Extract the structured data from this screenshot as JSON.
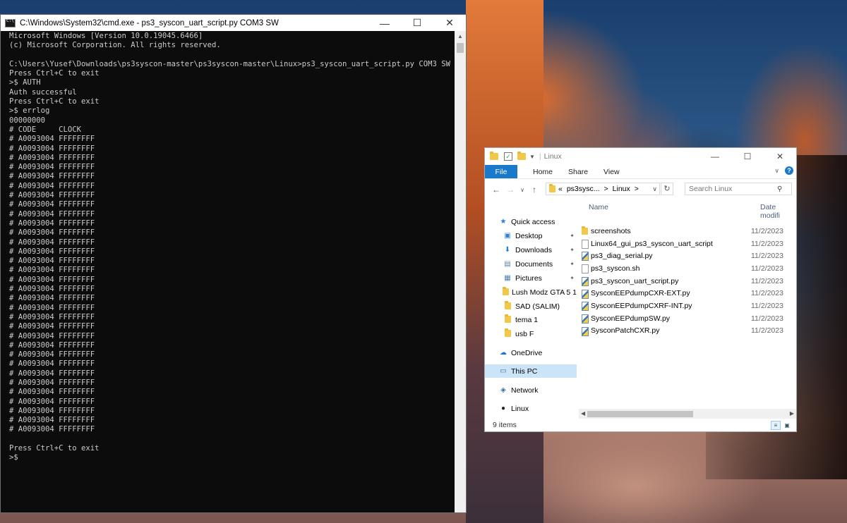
{
  "cmd": {
    "title": "C:\\Windows\\System32\\cmd.exe - ps3_syscon_uart_script.py  COM3 SW",
    "lines": [
      "Microsoft Windows [Version 10.0.19045.6466]",
      "(c) Microsoft Corporation. All rights reserved.",
      "",
      "C:\\Users\\Yusef\\Downloads\\ps3syscon-master\\ps3syscon-master\\Linux>ps3_syscon_uart_script.py COM3 SW",
      "Press Ctrl+C to exit",
      ">$ AUTH",
      "Auth successful",
      "Press Ctrl+C to exit",
      ">$ errlog",
      "00000000",
      "# CODE     CLOCK",
      "# A0093004 FFFFFFFF",
      "# A0093004 FFFFFFFF",
      "# A0093004 FFFFFFFF",
      "# A0093004 FFFFFFFF",
      "# A0093004 FFFFFFFF",
      "# A0093004 FFFFFFFF",
      "# A0093004 FFFFFFFF",
      "# A0093004 FFFFFFFF",
      "# A0093004 FFFFFFFF",
      "# A0093004 FFFFFFFF",
      "# A0093004 FFFFFFFF",
      "# A0093004 FFFFFFFF",
      "# A0093004 FFFFFFFF",
      "# A0093004 FFFFFFFF",
      "# A0093004 FFFFFFFF",
      "# A0093004 FFFFFFFF",
      "# A0093004 FFFFFFFF",
      "# A0093004 FFFFFFFF",
      "# A0093004 FFFFFFFF",
      "# A0093004 FFFFFFFF",
      "# A0093004 FFFFFFFF",
      "# A0093004 FFFFFFFF",
      "# A0093004 FFFFFFFF",
      "# A0093004 FFFFFFFF",
      "# A0093004 FFFFFFFF",
      "# A0093004 FFFFFFFF",
      "# A0093004 FFFFFFFF",
      "# A0093004 FFFFFFFF",
      "# A0093004 FFFFFFFF",
      "# A0093004 FFFFFFFF",
      "# A0093004 FFFFFFFF",
      "# A0093004 FFFFFFFF",
      "",
      "Press Ctrl+C to exit",
      ">$"
    ]
  },
  "explorer": {
    "title": "Linux",
    "ribbon": {
      "file": "File",
      "home": "Home",
      "share": "Share",
      "view": "View"
    },
    "address": {
      "overflow": "«",
      "parts": [
        "ps3sysc...",
        "Linux"
      ],
      "sep": ">"
    },
    "search": {
      "placeholder": "Search Linux"
    },
    "nav": [
      {
        "label": "Quick access",
        "icon": "star-icon",
        "pinned": false
      },
      {
        "label": "Desktop",
        "icon": "desktop-icon",
        "pinned": true
      },
      {
        "label": "Downloads",
        "icon": "download-icon",
        "pinned": true
      },
      {
        "label": "Documents",
        "icon": "documents-icon",
        "pinned": true
      },
      {
        "label": "Pictures",
        "icon": "pictures-icon",
        "pinned": true
      },
      {
        "label": "Lush Modz GTA 5 1.",
        "icon": "folder-icon",
        "pinned": false
      },
      {
        "label": "SAD (SALIM)",
        "icon": "folder-icon",
        "pinned": false
      },
      {
        "label": "tema 1",
        "icon": "folder-icon",
        "pinned": false
      },
      {
        "label": "usb F",
        "icon": "folder-icon",
        "pinned": false
      },
      {
        "label": "OneDrive",
        "icon": "cloud-icon",
        "pinned": false
      },
      {
        "label": "This PC",
        "icon": "computer-icon",
        "pinned": false
      },
      {
        "label": "Network",
        "icon": "network-icon",
        "pinned": false
      },
      {
        "label": "Linux",
        "icon": "penguin-icon",
        "pinned": false
      }
    ],
    "columns": {
      "name": "Name",
      "date": "Date modifi"
    },
    "files": [
      {
        "name": "screenshots",
        "date": "11/2/2023",
        "type": "folder"
      },
      {
        "name": "Linux64_gui_ps3_syscon_uart_script",
        "date": "11/2/2023",
        "type": "file"
      },
      {
        "name": "ps3_diag_serial.py",
        "date": "11/2/2023",
        "type": "python"
      },
      {
        "name": "ps3_syscon.sh",
        "date": "11/2/2023",
        "type": "file"
      },
      {
        "name": "ps3_syscon_uart_script.py",
        "date": "11/2/2023",
        "type": "python"
      },
      {
        "name": "SysconEEPdumpCXR-EXT.py",
        "date": "11/2/2023",
        "type": "python"
      },
      {
        "name": "SysconEEPdumpCXRF-INT.py",
        "date": "11/2/2023",
        "type": "python"
      },
      {
        "name": "SysconEEPdumpSW.py",
        "date": "11/2/2023",
        "type": "python"
      },
      {
        "name": "SysconPatchCXR.py",
        "date": "11/2/2023",
        "type": "python"
      }
    ],
    "status": "9 items",
    "selected_nav": "This PC"
  }
}
